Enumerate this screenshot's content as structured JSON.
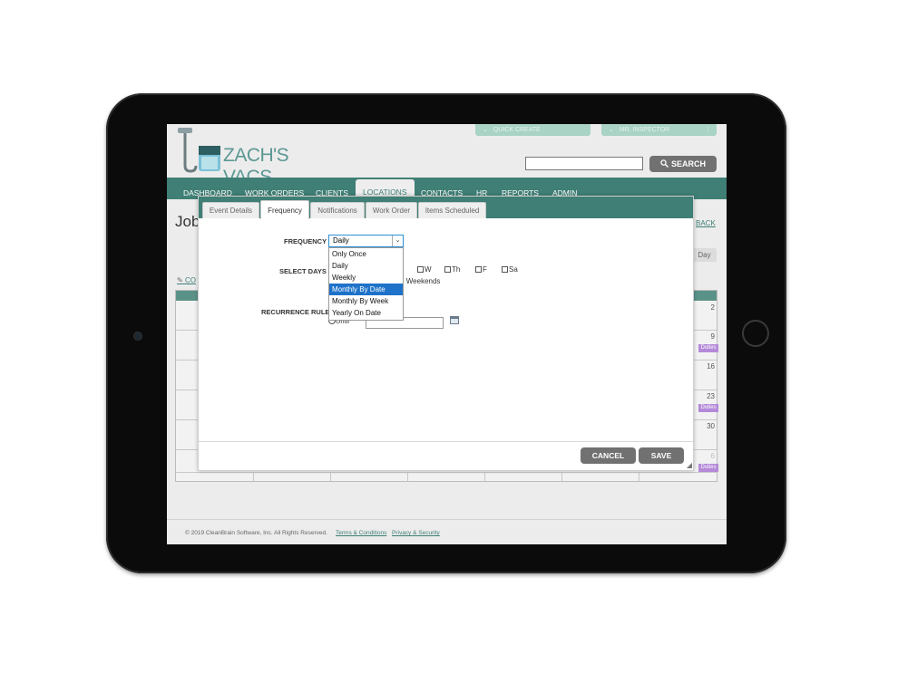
{
  "header": {
    "brand": "ZACH'S VACS",
    "quick_create": "QUICK CREATE",
    "user_menu": "MR. INSPECTOR",
    "user_menu_more": "⋮",
    "search_value": "",
    "search_label": "SEARCH"
  },
  "nav": {
    "items": [
      "DASHBOARD",
      "WORK ORDERS",
      "CLIENTS",
      "LOCATIONS",
      "CONTACTS",
      "HR",
      "REPORTS",
      "ADMIN"
    ],
    "active": "LOCATIONS"
  },
  "page": {
    "title": "Job",
    "back_link": "BACK",
    "view_button": "Day",
    "edit_link": "CO",
    "calendar": {
      "day_numbers": [
        "2",
        "9",
        "16",
        "23",
        "30",
        "6"
      ],
      "duties_label": "Duties"
    }
  },
  "footer": {
    "copyright": "© 2019 CleanBrain Software, Inc. All Rights Reserved.",
    "terms": "Terms & Conditions",
    "privacy": "Privacy & Security"
  },
  "modal": {
    "tabs": [
      "Event Details",
      "Frequency",
      "Notifications",
      "Work Order",
      "Items Scheduled"
    ],
    "active_tab": "Frequency",
    "frequency_label": "FREQUENCY",
    "frequency_value": "Daily",
    "frequency_options": [
      "Only Once",
      "Daily",
      "Weekly",
      "Monthly By Date",
      "Monthly By Week",
      "Yearly On Date"
    ],
    "frequency_highlighted": "Monthly By Date",
    "select_days_label": "SELECT DAYS",
    "days": [
      "W",
      "Th",
      "F",
      "Sa"
    ],
    "weekends_label": "ll Weekends",
    "recurrence_rule_label": "RECURRENCE RULE",
    "until_label": "Until",
    "until_value": "",
    "cancel_label": "CANCEL",
    "save_label": "SAVE"
  },
  "colors": {
    "brand_teal": "#3f7f75",
    "button_gray": "#717171",
    "highlight_blue": "#1e72c9",
    "duties_purple": "#b58ad9"
  }
}
